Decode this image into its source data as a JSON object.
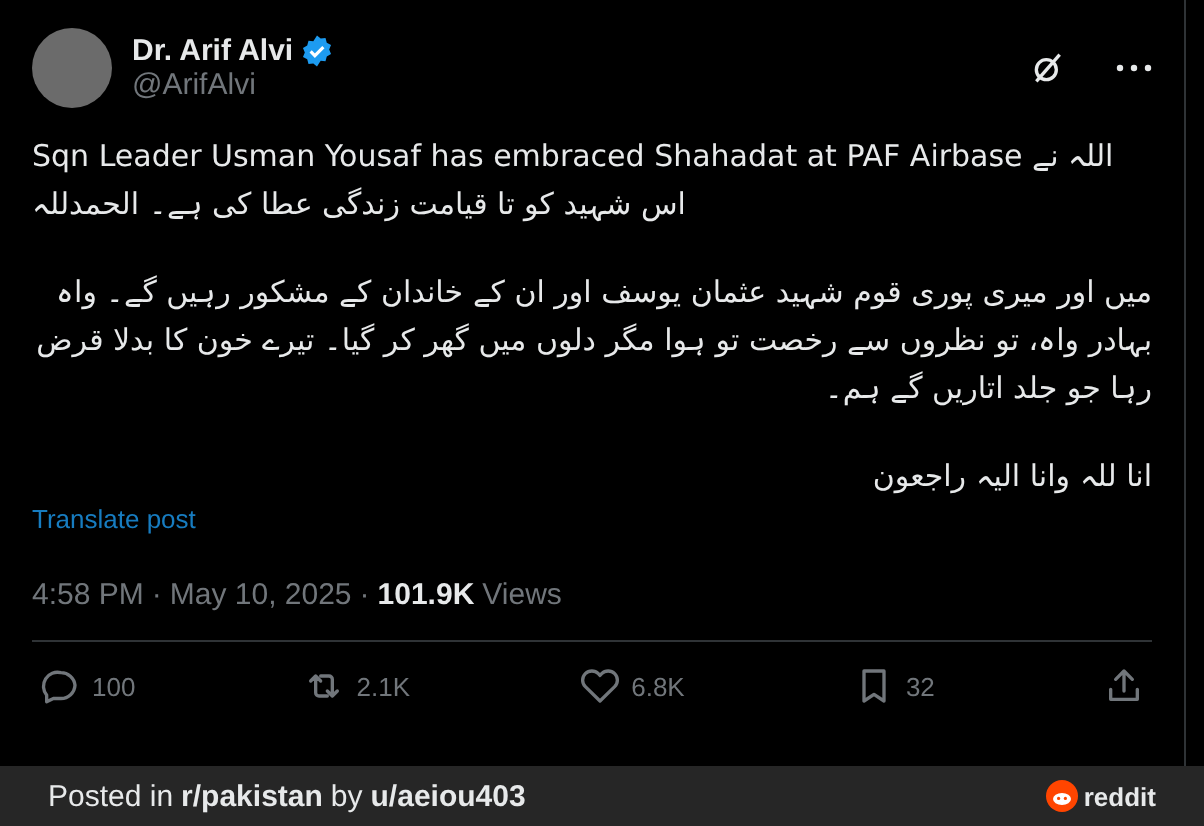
{
  "author": {
    "name": "Dr. Arif Alvi",
    "handle": "@ArifAlvi",
    "verified": true
  },
  "paragraphs": [
    {
      "text": "Sqn Leader Usman Yousaf has embraced Shahadat at PAF Airbase اللہ نے اس شہید کو تا قیامت زندگی عطا کی ہے۔ الحمدللہ",
      "kind": "mixed"
    },
    {
      "text": "میں اور میری پوری قوم شہید عثمان یوسف اور ان کے خاندان کے مشکور رہیں گے۔ واہ بہادر واہ، تو نظروں سے رخصت تو ہوا مگر دلوں میں گھر کر گیا۔ تیرے خون کا بدلا قرض رہا جو جلد اتاریں گے ہم۔",
      "kind": "urdu"
    },
    {
      "text": "انا للہ وانا الیہ راجعون",
      "kind": "urdu"
    }
  ],
  "translate_link": "Translate post",
  "meta": {
    "time": "4:58 PM",
    "separator": "·",
    "date": "May 10, 2025",
    "views_count": "101.9K",
    "views_label": "Views"
  },
  "actions": [
    {
      "kind": "reply",
      "count": "100"
    },
    {
      "kind": "repost",
      "count": "2.1K"
    },
    {
      "kind": "like",
      "count": "6.8K"
    },
    {
      "kind": "bookmark",
      "count": "32"
    },
    {
      "kind": "share"
    }
  ],
  "footer": {
    "posted_in": "Posted in",
    "subreddit": "r/pakistan",
    "by": "by",
    "user": "u/aeiou403",
    "brand": "reddit"
  }
}
